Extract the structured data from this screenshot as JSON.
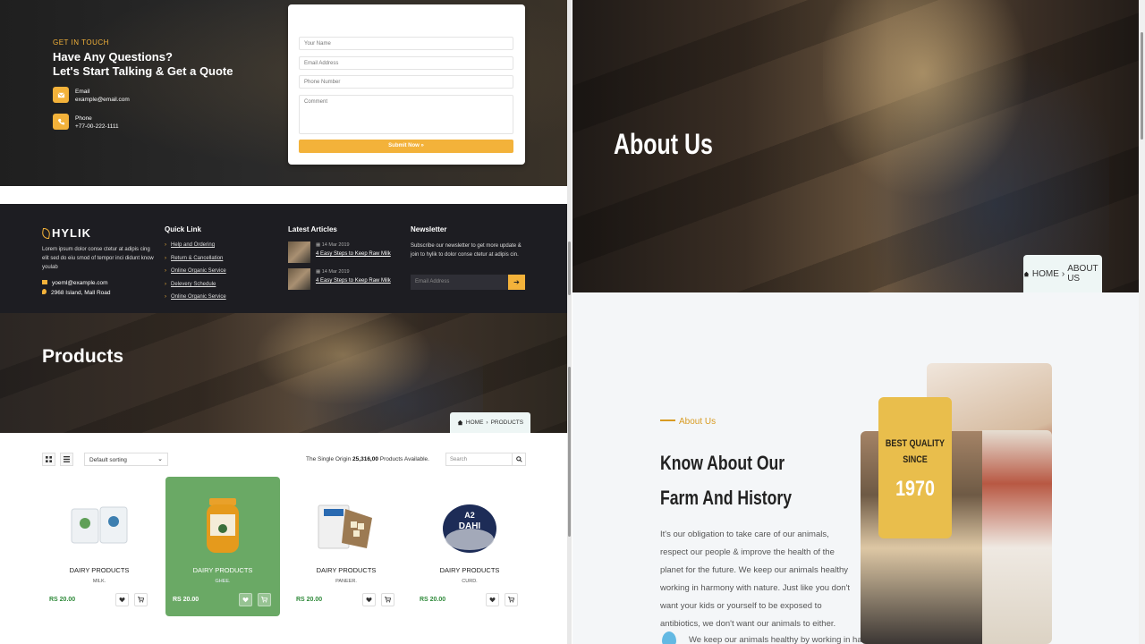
{
  "contact": {
    "eyebrow": "GET IN TOUCH",
    "heading_line1": "Have Any Questions?",
    "heading_line2": "Let's Start Talking & Get a Quote",
    "email_label": "Email",
    "email_value": "example@email.com",
    "phone_label": "Phone",
    "phone_value": "+77-00-222-1111",
    "form": {
      "name_placeholder": "Your Name",
      "email_placeholder": "Email Address",
      "phone_placeholder": "Phone Number",
      "comment_placeholder": "Comment",
      "submit_label": "Submit Now »"
    }
  },
  "footer": {
    "logo": "HYLIK",
    "about": "Lorem ipsum dolor conse ctetur at adipis cing elit sed do eiu smod of tempor inci didunt know youlab",
    "email": "yoeml@example.com",
    "address": "2968 Island, Mall Road",
    "quick_link_title": "Quick Link",
    "quick_links": [
      "Help and Ordering",
      "Return & Cancellation",
      "Online Organic Service",
      "Delevery Schedule",
      "Online Organic Service"
    ],
    "articles_title": "Latest Articles",
    "articles": [
      {
        "date": "14 Mar 2019",
        "title": "4 Easy Steps to Keep Raw Milk"
      },
      {
        "date": "14 Mar 2019",
        "title": "4 Easy Steps to Keep Raw Milk"
      }
    ],
    "newsletter_title": "Newsletter",
    "newsletter_text": "Subscribe our newsletter to get more update & join to hylik to dolor conse ctetur at adipis cin.",
    "newsletter_placeholder": "Email Address",
    "newsletter_button": "➔"
  },
  "products_page": {
    "title": "Products",
    "breadcrumb_home": "HOME",
    "breadcrumb_sep": "›",
    "breadcrumb_current": "PRODUCTS",
    "sort_value": "Default sorting",
    "availability_prefix": "The Single Origin",
    "availability_count": "25,316,00",
    "availability_suffix": "Products Available.",
    "search_placeholder": "Search",
    "products": [
      {
        "name": "DAIRY PRODUCTS",
        "sub": "MILK.",
        "price": "RS 20.00",
        "highlighted": false
      },
      {
        "name": "DAIRY PRODUCTS",
        "sub": "GHEE.",
        "price": "RS 20.00",
        "highlighted": true
      },
      {
        "name": "DAIRY PRODUCTS",
        "sub": "PANEER.",
        "price": "RS 20.00",
        "highlighted": false
      },
      {
        "name": "DAIRY PRODUCTS",
        "sub": "CURD.",
        "price": "RS 20.00",
        "highlighted": false
      }
    ]
  },
  "about_page": {
    "title": "About Us",
    "breadcrumb_home": "HOME",
    "breadcrumb_sep": "›",
    "breadcrumb_current": "ABOUT US",
    "eyebrow": "About Us",
    "heading_line1": "Know About Our",
    "heading_line2": "Farm And History",
    "paragraph": "It's our obligation to take care of our animals, respect our people & improve the health of the planet for the future. We keep our animals healthy working in harmony with nature. Just like you don't want your kids or yourself to be exposed to antibiotics, we don't want our animals to either.",
    "feature_text": "We keep our animals healthy by working in harmony with",
    "badge_line1": "BEST QUALITY",
    "badge_line2": "SINCE",
    "badge_year": "1970"
  },
  "colors": {
    "accent": "#f3b23a",
    "green": "#6aa965",
    "price": "#2f8a3a",
    "footer_bg": "#1d1d22"
  }
}
